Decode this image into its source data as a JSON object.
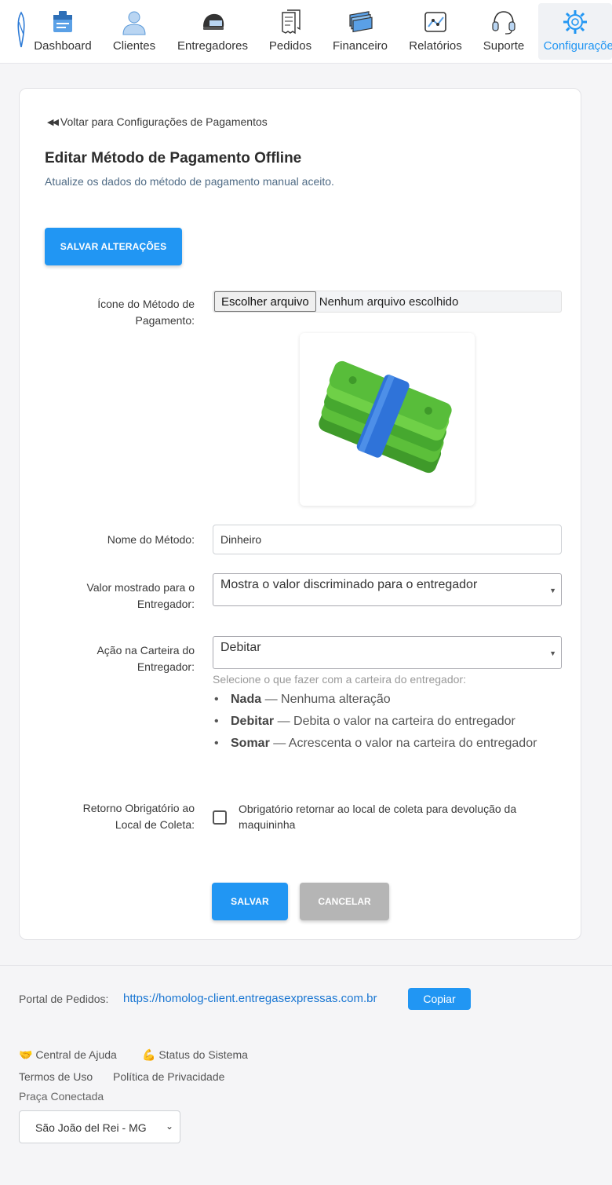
{
  "nav": {
    "items": [
      {
        "label": "Dashboard",
        "icon": "dashboard-icon"
      },
      {
        "label": "Clientes",
        "icon": "user-icon"
      },
      {
        "label": "Entregadores",
        "icon": "helmet-icon"
      },
      {
        "label": "Pedidos",
        "icon": "receipt-icon"
      },
      {
        "label": "Financeiro",
        "icon": "money-stack-icon"
      },
      {
        "label": "Relatórios",
        "icon": "chart-icon"
      },
      {
        "label": "Suporte",
        "icon": "headset-icon"
      },
      {
        "label": "Configurações",
        "icon": "gear-icon",
        "active": true
      }
    ],
    "accent_color": "#2196f3"
  },
  "card": {
    "back_link": "Voltar para Configurações de Pagamentos",
    "title": "Editar Método de Pagamento Offline",
    "subtitle": "Atualize os dados do método de pagamento manual aceito.",
    "save_changes_label": "SALVAR ALTERAÇÕES",
    "icon_field": {
      "label_line1": "Ícone do Método de",
      "label_line2": "Pagamento:",
      "file_button": "Escolher arquivo",
      "file_status": "Nenhum arquivo escolhido",
      "preview_icon": "cash-bundle-icon"
    },
    "name_field": {
      "label": "Nome do Método:",
      "value": "Dinheiro"
    },
    "value_field": {
      "label_line1": "Valor mostrado para o",
      "label_line2": "Entregador:",
      "selected": "Mostra o valor discriminado para o entregador"
    },
    "wallet_field": {
      "label_line1": "Ação na Carteira do",
      "label_line2": "Entregador:",
      "selected": "Debitar",
      "hint": "Selecione o que fazer com a carteira do entregador:",
      "options": [
        {
          "name": "Nada",
          "desc": " — Nenhuma alteração"
        },
        {
          "name": "Debitar",
          "desc": " — Debita o valor na carteira do entregador"
        },
        {
          "name": "Somar",
          "desc": " — Acrescenta o valor na carteira do entregador"
        }
      ]
    },
    "return_field": {
      "label_line1": "Retorno Obrigatório ao",
      "label_line2": "Local de Coleta:",
      "checkbox_label": "Obrigatório retornar ao local de coleta para devolução da maquininha",
      "checked": false
    },
    "save_label": "SALVAR",
    "cancel_label": "CANCELAR"
  },
  "footer": {
    "portal_label": "Portal de Pedidos:",
    "portal_url": "https://homolog-client.entregasexpressas.com.br",
    "copy_label": "Copiar",
    "help_link": "🤝 Central de Ajuda",
    "status_link": "💪 Status do Sistema",
    "terms_link": "Termos de Uso",
    "privacy_link": "Política de Privacidade",
    "praca_label": "Praça Conectada",
    "praca_selected": "São João del Rei - MG"
  }
}
